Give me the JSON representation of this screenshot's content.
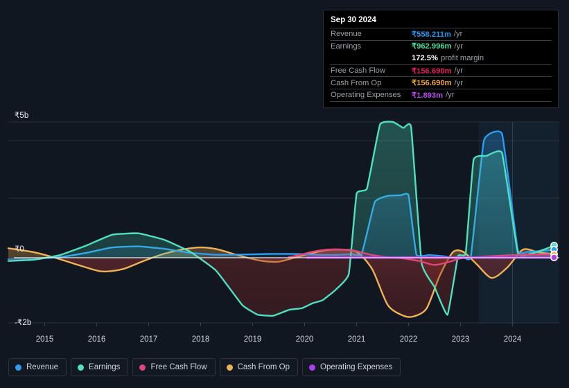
{
  "tooltip": {
    "date": "Sep 30 2024",
    "rows": [
      {
        "name": "Revenue",
        "value": "₹558.211m",
        "unit": "/yr",
        "color": "#2196f3"
      },
      {
        "name": "Earnings",
        "value": "₹962.996m",
        "unit": "/yr",
        "color": "#4ade9f"
      },
      {
        "name": "",
        "value": "172.5%",
        "unit": "profit margin",
        "color": "#ffffff"
      },
      {
        "name": "Free Cash Flow",
        "value": "₹156.690m",
        "unit": "/yr",
        "color": "#e91e63"
      },
      {
        "name": "Cash From Op",
        "value": "₹156.690m",
        "unit": "/yr",
        "color": "#f0a83c"
      },
      {
        "name": "Operating Expenses",
        "value": "₹1.893m",
        "unit": "/yr",
        "color": "#b84df0"
      }
    ]
  },
  "legend": {
    "items": [
      {
        "label": "Revenue",
        "color": "#2d9cf0"
      },
      {
        "label": "Earnings",
        "color": "#4fe0c0"
      },
      {
        "label": "Free Cash Flow",
        "color": "#e0467c"
      },
      {
        "label": "Cash From Op",
        "color": "#efb254"
      },
      {
        "label": "Operating Expenses",
        "color": "#b13df0"
      }
    ]
  },
  "chart_data": {
    "type": "area",
    "title": "",
    "xlabel": "",
    "ylabel": "",
    "ylim": [
      -2,
      5
    ],
    "ytick_labels": [
      "₹5b",
      "₹0",
      "-₹2b"
    ],
    "ytick_values": [
      5,
      0,
      -2
    ],
    "xtick_labels": [
      "2015",
      "2016",
      "2017",
      "2018",
      "2019",
      "2020",
      "2021",
      "2022",
      "2023",
      "2024"
    ],
    "xlim": [
      2014.3,
      2024.9
    ],
    "grid": true,
    "legend_position": "bottom",
    "currency": "INR",
    "units": "billions",
    "forecast_start": 2023.35,
    "series": [
      {
        "name": "Revenue",
        "color": "#2d9cf0",
        "x": [
          2014.3,
          2014.8,
          2015.3,
          2015.8,
          2016.3,
          2016.8,
          2017.3,
          2017.8,
          2018.3,
          2018.8,
          2019.3,
          2019.8,
          2020.1,
          2020.4,
          2020.7,
          2020.9,
          2021.1,
          2021.35,
          2021.6,
          2021.85,
          2022.0,
          2022.15,
          2022.4,
          2022.7,
          2022.9,
          2023.05,
          2023.2,
          2023.45,
          2023.8,
          2024.1,
          2024.3,
          2024.55,
          2024.8
        ],
        "y": [
          -0.04,
          -0.02,
          0.02,
          0.18,
          0.38,
          0.42,
          0.33,
          0.18,
          0.11,
          0.12,
          0.14,
          0.14,
          0.12,
          0.1,
          0.11,
          0.13,
          0.15,
          2.05,
          2.28,
          2.3,
          2.3,
          0.12,
          0.1,
          0.05,
          -0.02,
          0.02,
          0.06,
          4.32,
          4.55,
          0.3,
          0.22,
          0.25,
          0.3
        ]
      },
      {
        "name": "Earnings",
        "color": "#4fe0c0",
        "x": [
          2014.3,
          2014.8,
          2015.3,
          2015.8,
          2016.3,
          2016.8,
          2017.3,
          2017.8,
          2018.3,
          2018.8,
          2019.1,
          2019.4,
          2019.7,
          2019.95,
          2020.15,
          2020.35,
          2020.6,
          2020.85,
          2021.0,
          2021.2,
          2021.45,
          2021.7,
          2021.9,
          2022.05,
          2022.25,
          2022.5,
          2022.75,
          2022.95,
          2023.1,
          2023.25,
          2023.5,
          2023.8,
          2024.1,
          2024.35,
          2024.6,
          2024.8
        ],
        "y": [
          -0.1,
          -0.06,
          0.1,
          0.45,
          0.85,
          0.9,
          0.66,
          0.22,
          -0.4,
          -1.45,
          -1.75,
          -1.78,
          -1.6,
          -1.55,
          -1.4,
          -1.3,
          -0.98,
          -0.5,
          2.35,
          2.55,
          4.9,
          5.0,
          4.78,
          4.8,
          -0.15,
          -0.9,
          -1.75,
          0.05,
          0.18,
          3.6,
          3.75,
          3.85,
          0.2,
          0.15,
          0.3,
          0.45
        ]
      },
      {
        "name": "Free Cash Flow",
        "color": "#e0467c",
        "x": [
          2019.7,
          2019.9,
          2020.15,
          2020.45,
          2020.75,
          2021.0,
          2021.3,
          2021.6,
          2021.9,
          2022.2,
          2022.5,
          2022.8,
          2023.0,
          2023.3,
          2023.6,
          2024.0,
          2024.4,
          2024.8
        ],
        "y": [
          0.02,
          0.1,
          0.22,
          0.3,
          0.3,
          0.24,
          0.1,
          0.02,
          -0.02,
          -0.1,
          -0.22,
          -0.12,
          -0.02,
          0.02,
          0.06,
          0.1,
          0.12,
          0.13
        ]
      },
      {
        "name": "Cash From Op",
        "color": "#efb254",
        "x": [
          2014.3,
          2014.8,
          2015.2,
          2015.7,
          2016.1,
          2016.5,
          2016.9,
          2017.3,
          2017.7,
          2018.0,
          2018.3,
          2018.6,
          2018.9,
          2019.2,
          2019.5,
          2019.8,
          2020.1,
          2020.4,
          2020.7,
          2021.0,
          2021.3,
          2021.6,
          2021.9,
          2022.1,
          2022.35,
          2022.6,
          2022.85,
          2023.05,
          2023.3,
          2023.6,
          2023.9,
          2024.2,
          2024.5,
          2024.8
        ],
        "y": [
          0.35,
          0.2,
          0.0,
          -0.25,
          -0.42,
          -0.35,
          -0.1,
          0.15,
          0.32,
          0.38,
          0.32,
          0.16,
          0.0,
          -0.1,
          -0.12,
          0.0,
          0.15,
          0.28,
          0.3,
          0.22,
          -0.35,
          -1.45,
          -1.78,
          -1.8,
          -1.55,
          -0.55,
          0.2,
          0.22,
          -0.18,
          -0.62,
          -0.3,
          0.3,
          0.2,
          0.13
        ]
      },
      {
        "name": "Operating Expenses",
        "color": "#b13df0",
        "x": [
          2020.05,
          2021.0,
          2022.0,
          2023.0,
          2024.0,
          2024.8
        ],
        "y": [
          0.01,
          0.01,
          0.01,
          0.01,
          0.01,
          0.01
        ]
      }
    ]
  }
}
